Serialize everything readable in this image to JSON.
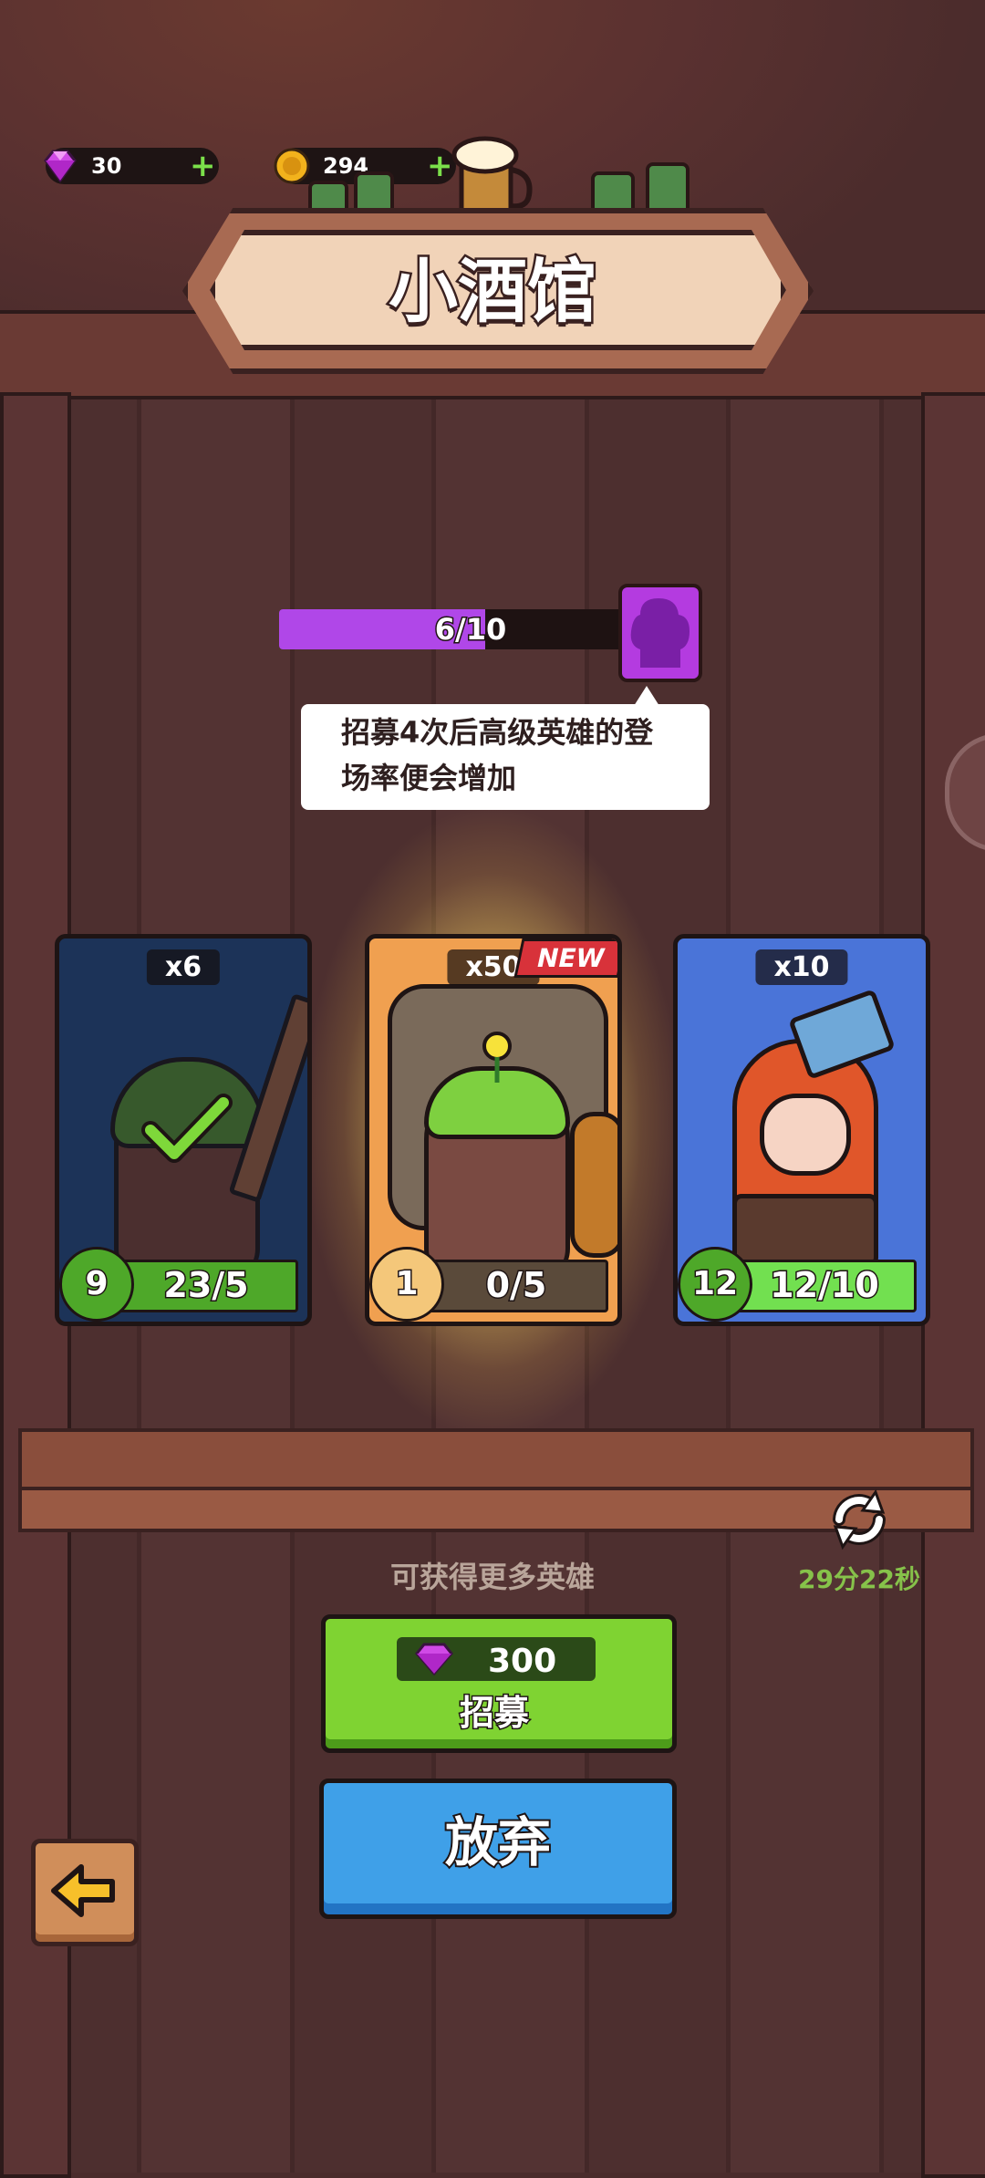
{
  "currency": {
    "gems": "30",
    "coins": "294"
  },
  "title": "小酒馆",
  "progress": {
    "label": "6/10",
    "fraction": 0.6
  },
  "tooltip": {
    "line1": "招募4次后高级英雄的登",
    "line2": "场率便会增加"
  },
  "cards": [
    {
      "count": "x6",
      "level": "9",
      "progress": "23/5",
      "rarity_color": "#2b4a8a",
      "bar_color": "#4ea829"
    },
    {
      "count": "x50",
      "level": "1",
      "progress": "0/5",
      "rarity_color": "#f0a050",
      "bar_color": "#5a4a3a",
      "badge": "NEW"
    },
    {
      "count": "x10",
      "level": "12",
      "progress": "12/10",
      "rarity_color": "#4a74d8",
      "bar_color": "#72e050"
    }
  ],
  "more_heroes": "可获得更多英雄",
  "timer": "29分22秒",
  "recruit": {
    "cost": "300",
    "label": "招募"
  },
  "give_up": "放弃",
  "icons": {
    "gem": "gem-icon",
    "coin": "coin-icon",
    "refresh": "refresh-icon",
    "back": "back-arrow-icon"
  }
}
